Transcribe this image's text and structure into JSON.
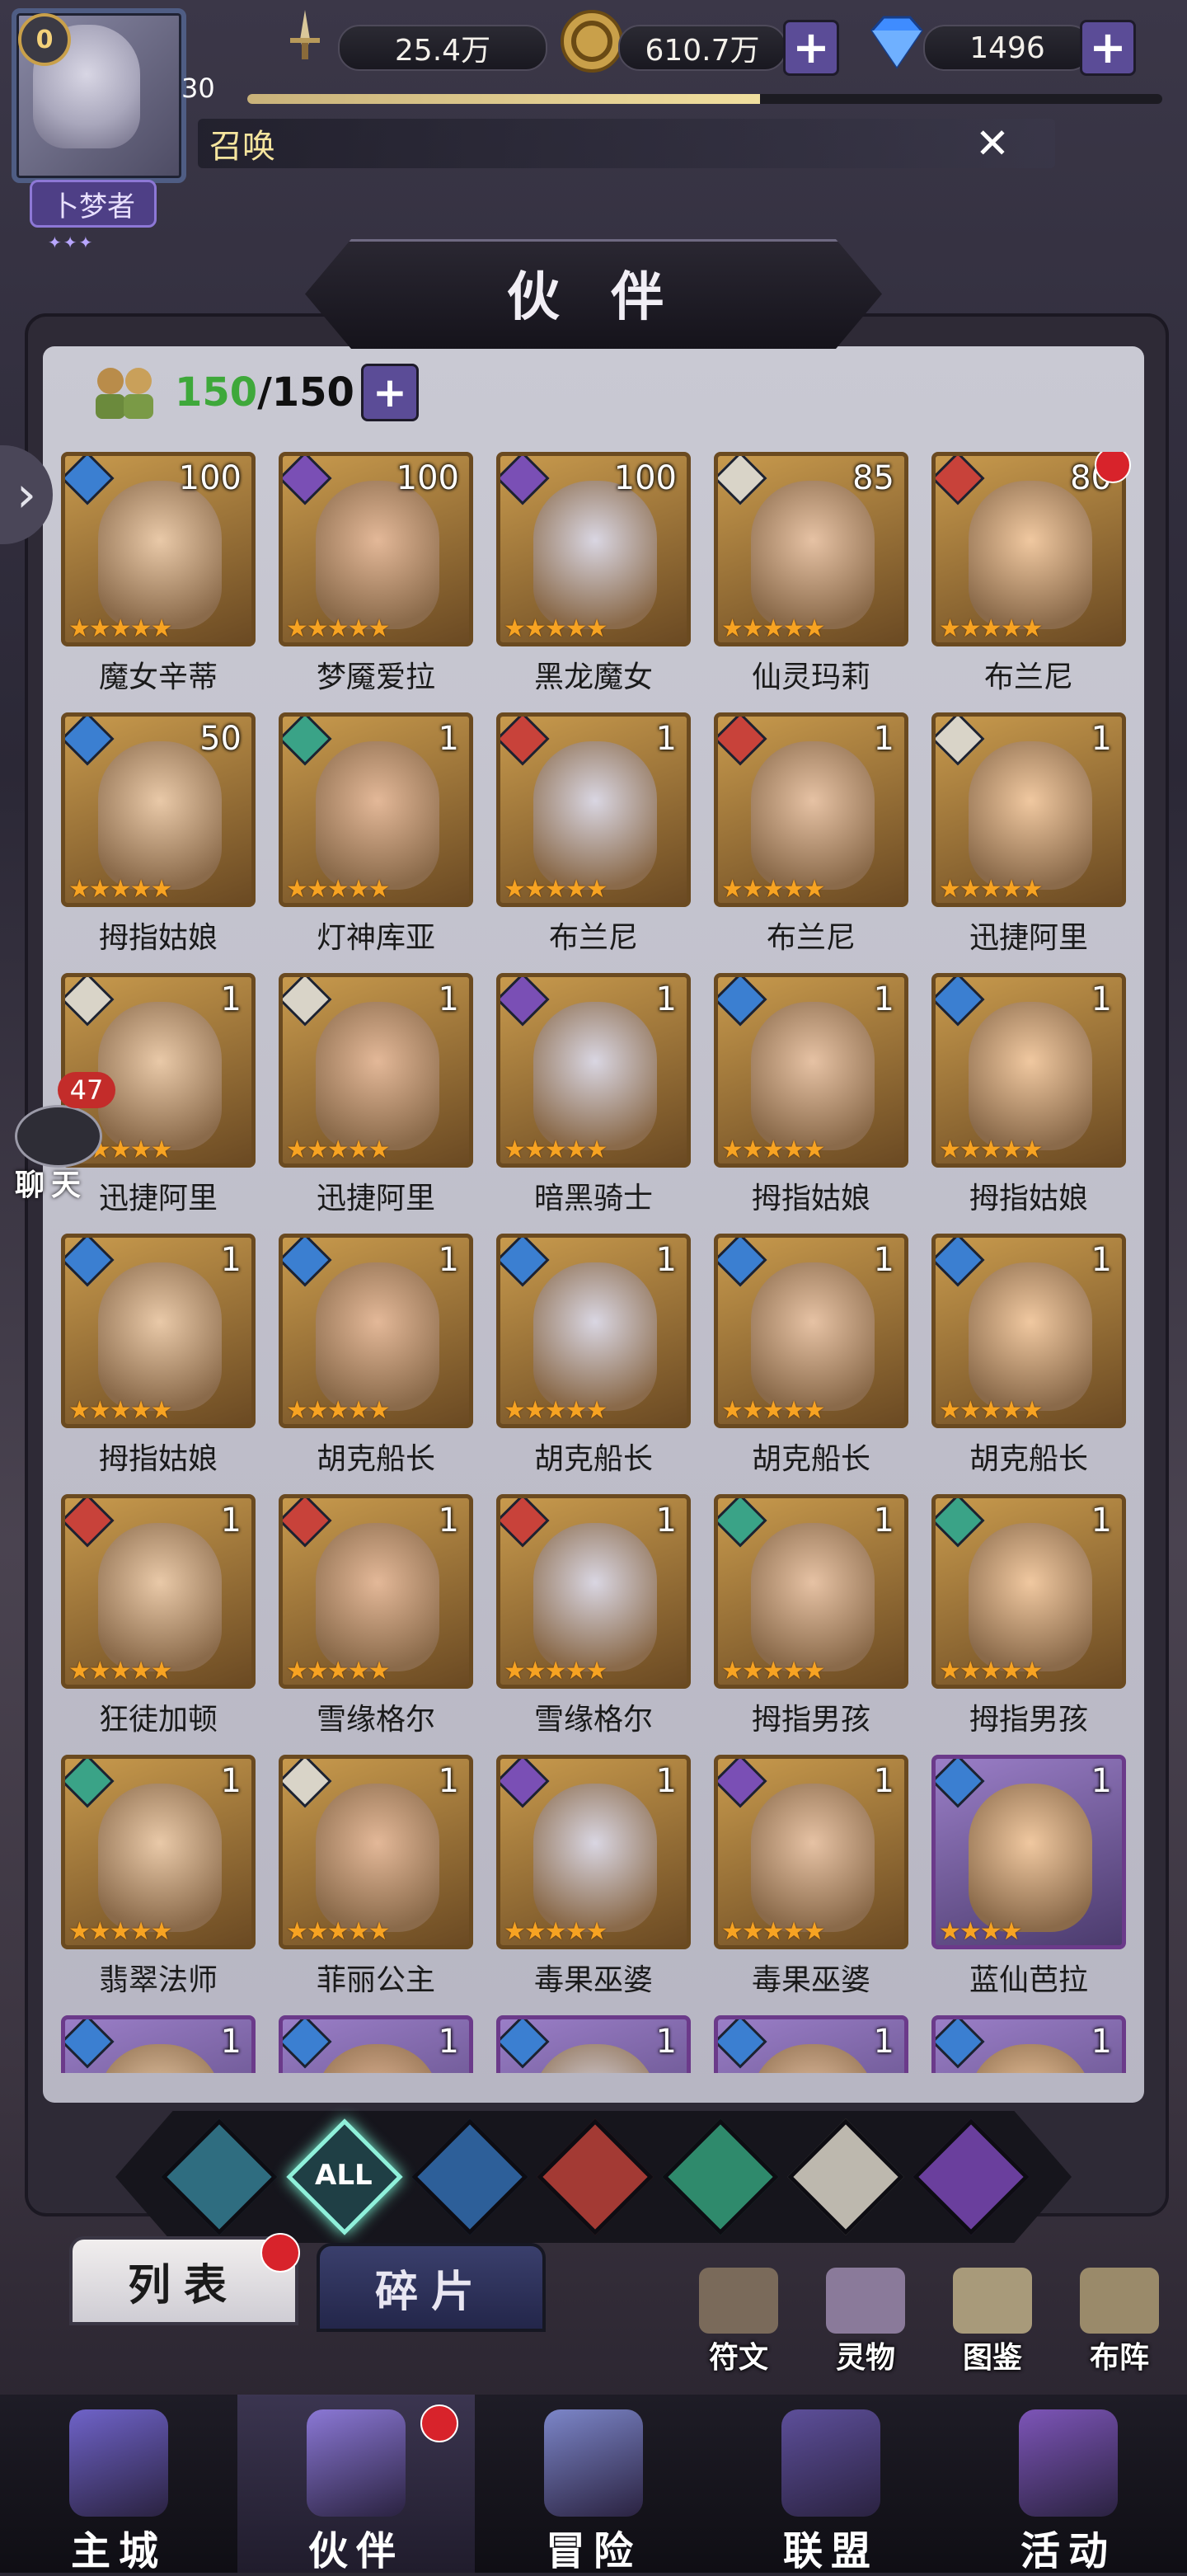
{
  "header": {
    "vip_level": "0",
    "player_title": "卜梦者",
    "player_level": "30",
    "xp_fraction": 0.56,
    "power": "25.4万",
    "gold": "610.7万",
    "gems": "1496",
    "notice_text": "召唤",
    "colors": {
      "gold": "#c9a04a",
      "gem": "#3f8cff",
      "title_bg": "#4e3f86"
    }
  },
  "panel": {
    "title": "伙 伴",
    "capacity_current": "150",
    "capacity_sep_max": "/150"
  },
  "chat": {
    "badge": "47",
    "label": "聊天"
  },
  "heroes": [
    {
      "name": "魔女辛蒂",
      "level": "100",
      "element": "water",
      "stars": 5,
      "dot": false
    },
    {
      "name": "梦魇爱拉",
      "level": "100",
      "element": "dark",
      "stars": 5,
      "dot": false
    },
    {
      "name": "黑龙魔女",
      "level": "100",
      "element": "dark",
      "stars": 5,
      "dot": false
    },
    {
      "name": "仙灵玛莉",
      "level": "85",
      "element": "light",
      "stars": 5,
      "dot": false
    },
    {
      "name": "布兰尼",
      "level": "80",
      "element": "fire",
      "stars": 5,
      "dot": true
    },
    {
      "name": "拇指姑娘",
      "level": "50",
      "element": "water",
      "stars": 5,
      "dot": false
    },
    {
      "name": "灯神库亚",
      "level": "1",
      "element": "wind",
      "stars": 5,
      "dot": false
    },
    {
      "name": "布兰尼",
      "level": "1",
      "element": "fire",
      "stars": 5,
      "dot": false
    },
    {
      "name": "布兰尼",
      "level": "1",
      "element": "fire",
      "stars": 5,
      "dot": false
    },
    {
      "name": "迅捷阿里",
      "level": "1",
      "element": "light",
      "stars": 5,
      "dot": false
    },
    {
      "name": "迅捷阿里",
      "level": "1",
      "element": "light",
      "stars": 5,
      "dot": false
    },
    {
      "name": "迅捷阿里",
      "level": "1",
      "element": "light",
      "stars": 5,
      "dot": false
    },
    {
      "name": "暗黑骑士",
      "level": "1",
      "element": "dark",
      "stars": 5,
      "dot": false
    },
    {
      "name": "拇指姑娘",
      "level": "1",
      "element": "water",
      "stars": 5,
      "dot": false
    },
    {
      "name": "拇指姑娘",
      "level": "1",
      "element": "water",
      "stars": 5,
      "dot": false
    },
    {
      "name": "拇指姑娘",
      "level": "1",
      "element": "water",
      "stars": 5,
      "dot": false
    },
    {
      "name": "胡克船长",
      "level": "1",
      "element": "water",
      "stars": 5,
      "dot": false
    },
    {
      "name": "胡克船长",
      "level": "1",
      "element": "water",
      "stars": 5,
      "dot": false
    },
    {
      "name": "胡克船长",
      "level": "1",
      "element": "water",
      "stars": 5,
      "dot": false
    },
    {
      "name": "胡克船长",
      "level": "1",
      "element": "water",
      "stars": 5,
      "dot": false
    },
    {
      "name": "狂徒加顿",
      "level": "1",
      "element": "fire",
      "stars": 5,
      "dot": false
    },
    {
      "name": "雪缘格尔",
      "level": "1",
      "element": "fire",
      "stars": 5,
      "dot": false
    },
    {
      "name": "雪缘格尔",
      "level": "1",
      "element": "fire",
      "stars": 5,
      "dot": false
    },
    {
      "name": "拇指男孩",
      "level": "1",
      "element": "wind",
      "stars": 5,
      "dot": false
    },
    {
      "name": "拇指男孩",
      "level": "1",
      "element": "wind",
      "stars": 5,
      "dot": false
    },
    {
      "name": "翡翠法师",
      "level": "1",
      "element": "wind",
      "stars": 5,
      "dot": false
    },
    {
      "name": "菲丽公主",
      "level": "1",
      "element": "light",
      "stars": 5,
      "dot": false
    },
    {
      "name": "毒果巫婆",
      "level": "1",
      "element": "dark",
      "stars": 5,
      "dot": false
    },
    {
      "name": "毒果巫婆",
      "level": "1",
      "element": "dark",
      "stars": 5,
      "dot": false
    },
    {
      "name": "蓝仙芭拉",
      "level": "1",
      "element": "water",
      "stars": 4,
      "dot": false,
      "purple": true
    },
    {
      "name": "",
      "level": "1",
      "element": "water",
      "stars": 0,
      "dot": false,
      "purple": true
    },
    {
      "name": "",
      "level": "1",
      "element": "water",
      "stars": 0,
      "dot": false,
      "purple": true
    },
    {
      "name": "",
      "level": "1",
      "element": "water",
      "stars": 0,
      "dot": false,
      "purple": true
    },
    {
      "name": "",
      "level": "1",
      "element": "water",
      "stars": 0,
      "dot": false,
      "purple": true
    },
    {
      "name": "",
      "level": "1",
      "element": "water",
      "stars": 0,
      "dot": false,
      "purple": true
    }
  ],
  "element_colors": {
    "water": "#3b7fd1",
    "dark": "#7a4fb5",
    "light": "#d9d4c8",
    "fire": "#c8423a",
    "wind": "#3aa387",
    "all": "#2f8a7a"
  },
  "filters": [
    {
      "key": "wind-alt",
      "label": "",
      "color": "#2f6d80"
    },
    {
      "key": "all",
      "label": "ALL",
      "color": "#1f3f45"
    },
    {
      "key": "water",
      "label": "",
      "color": "#2d5f99"
    },
    {
      "key": "fire",
      "label": "",
      "color": "#a33a34"
    },
    {
      "key": "wind",
      "label": "",
      "color": "#2f8a6c"
    },
    {
      "key": "light",
      "label": "",
      "color": "#bdb8ae"
    },
    {
      "key": "dark",
      "label": "",
      "color": "#6a3f9d"
    }
  ],
  "tabs": {
    "list": "列表",
    "fragments": "碎片"
  },
  "tools": [
    "符文",
    "灵物",
    "图鉴",
    "布阵"
  ],
  "nav": [
    "主城",
    "伙伴",
    "冒险",
    "联盟",
    "活动"
  ]
}
